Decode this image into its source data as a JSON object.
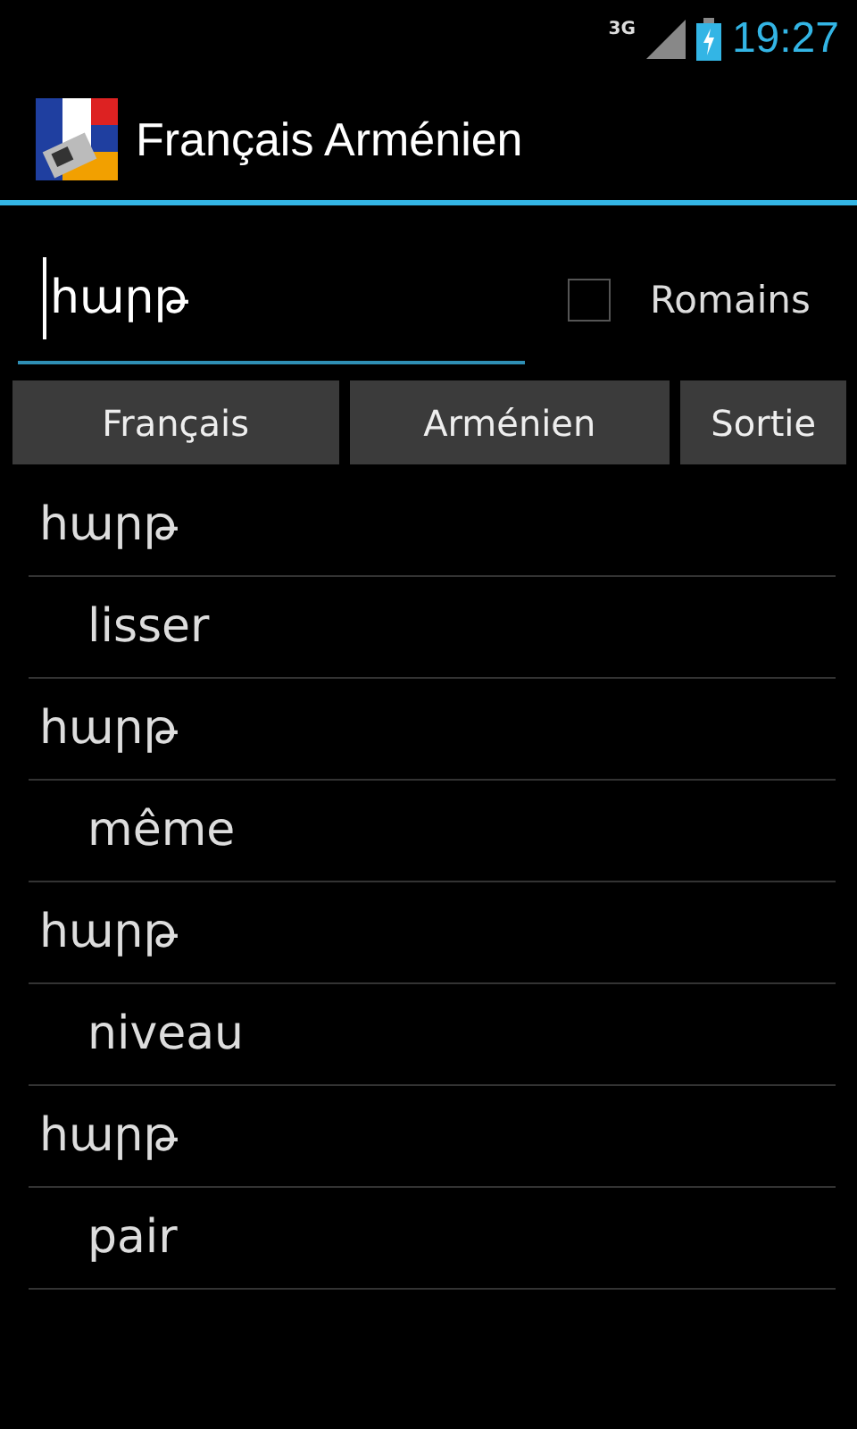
{
  "status_bar": {
    "network": "3G",
    "time": "19:27"
  },
  "action_bar": {
    "title": "Français Arménien"
  },
  "search": {
    "value": "հարթ"
  },
  "romains": {
    "label": "Romains",
    "checked": false
  },
  "buttons": [
    "Français",
    "Arménien",
    "Sortie"
  ],
  "results": [
    {
      "kind": "term",
      "text": "հարթ"
    },
    {
      "kind": "translation",
      "text": "lisser"
    },
    {
      "kind": "term",
      "text": "հարթ"
    },
    {
      "kind": "translation",
      "text": "même"
    },
    {
      "kind": "term",
      "text": "հարթ"
    },
    {
      "kind": "translation",
      "text": "niveau"
    },
    {
      "kind": "term",
      "text": "հարթ"
    },
    {
      "kind": "translation",
      "text": "pair"
    }
  ]
}
